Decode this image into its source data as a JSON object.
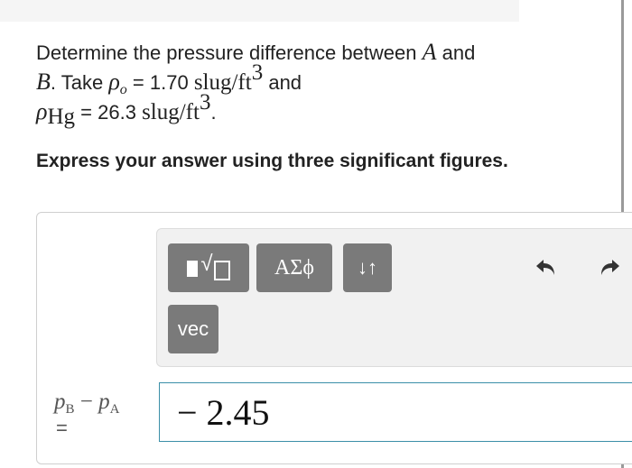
{
  "problem": {
    "line1_text": "Determine the pressure difference between ",
    "var_A": "A",
    "line1_and": " and",
    "var_B": "B",
    "line2_take": ". Take ",
    "rho": "ρ",
    "rho_o_sub": "o",
    "line2_eq": " = 1.70 ",
    "unit": "slug/ft",
    "unit_exp": "3",
    "line2_and": " and",
    "rho_hg_sub": "Hg",
    "line3_eq": " = 26.3 ",
    "line3_end": "."
  },
  "instruction": "Express your answer using three significant figures.",
  "toolbar": {
    "greek_label": "ΑΣϕ",
    "arrows_label": "↓↑",
    "vec_label": "vec"
  },
  "answer": {
    "var_p": "p",
    "sub_B": "B",
    "minus": " − ",
    "sub_A": "A",
    "equals": "=",
    "value": "− 2.45"
  },
  "icons": {
    "templates": "templates-icon",
    "undo": "undo-icon",
    "redo": "redo-icon"
  }
}
